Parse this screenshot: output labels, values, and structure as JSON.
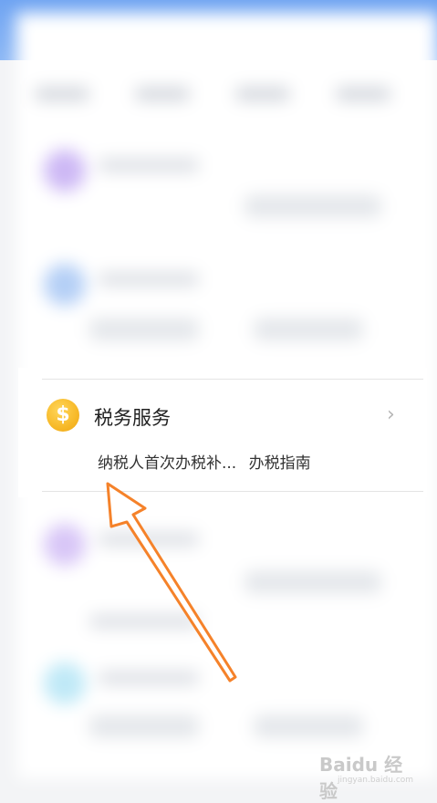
{
  "tax_service": {
    "icon": "dollar-coin-icon",
    "icon_glyph": "$",
    "title": "税务服务",
    "chevron": "›",
    "links": [
      "纳税人首次办税补...",
      "办税指南"
    ]
  },
  "watermark": {
    "text": "Baidu 经验",
    "url": "jingyan.baidu.com"
  },
  "colors": {
    "header_blue": "#6fa4f2",
    "coin_gold": "#f7b928",
    "arrow_orange": "#f5822a"
  }
}
